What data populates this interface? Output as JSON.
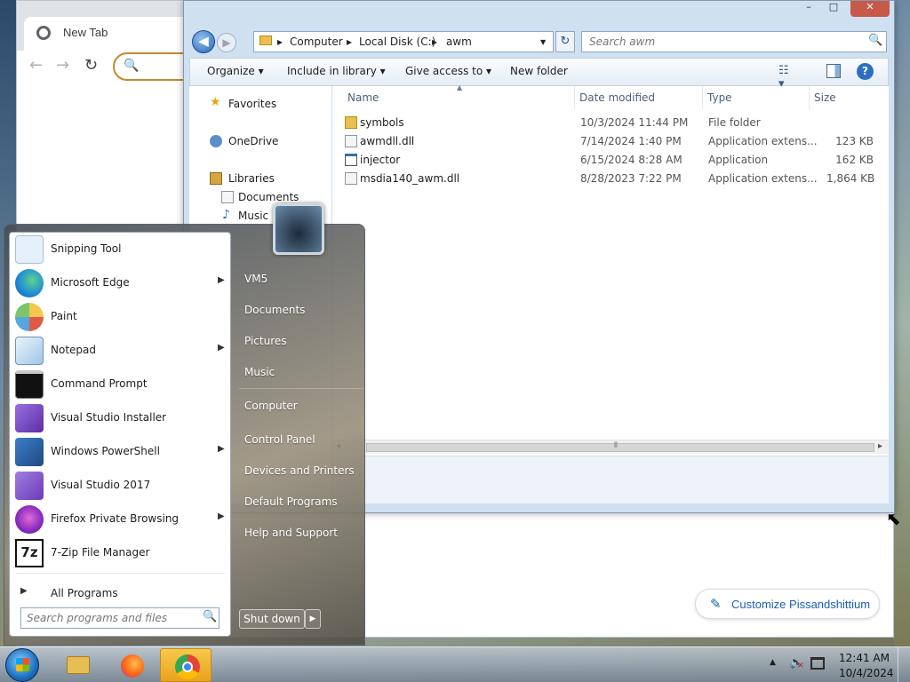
{
  "chrome": {
    "tab_title": "New Tab",
    "tab_close": "×",
    "nav_back": "←",
    "nav_forward": "→",
    "nav_reload": "↻",
    "omnibox_icon": "search-icon",
    "omnibox_glyph": "🔍",
    "customize_label": "Customize Pissandshittium",
    "customize_icon": "pencil-icon",
    "customize_glyph": "✎"
  },
  "explorer": {
    "window_buttons": {
      "minimize": "–",
      "maximize": "□",
      "close": "✕"
    },
    "nav_back_glyph": "◀",
    "nav_forward_glyph": "▶",
    "breadcrumb": [
      "Computer",
      "Local Disk (C:)",
      "awm"
    ],
    "breadcrumb_sep": "▸",
    "breadcrumb_dropdown": "▼",
    "refresh_glyph": "↻",
    "search_placeholder": "Search awm",
    "search_glyph": "🔍",
    "toolbar": {
      "organize": "Organize ▾",
      "include_in_library": "Include in library ▾",
      "give_access_to": "Give access to ▾",
      "new_folder": "New folder",
      "view_glyph": "☷ ▾",
      "help_glyph": "?"
    },
    "nav_pane": {
      "favorites": "Favorites",
      "onedrive": "OneDrive",
      "libraries": "Libraries",
      "documents": "Documents",
      "music": "Music"
    },
    "columns": {
      "name": "Name",
      "date_modified": "Date modified",
      "type": "Type",
      "size": "Size",
      "sort_glyph": "▲"
    },
    "files": [
      {
        "name": "symbols",
        "date": "10/3/2024 11:44 PM",
        "type": "File folder",
        "size": ""
      },
      {
        "name": "awmdll.dll",
        "date": "7/14/2024 1:40 PM",
        "type": "Application extens...",
        "size": "123 KB"
      },
      {
        "name": "injector",
        "date": "6/15/2024 8:28 AM",
        "type": "Application",
        "size": "162 KB"
      },
      {
        "name": "msdia140_awm.dll",
        "date": "8/28/2023 7:22 PM",
        "type": "Application extens...",
        "size": "1,864 KB"
      }
    ],
    "hscroll_left": "◂",
    "hscroll_right": "▸",
    "hscroll_grip": "⦀"
  },
  "start_menu": {
    "programs": [
      {
        "label": "Snipping Tool",
        "icon": "scissors-icon",
        "arrow": "",
        "color": "#e6f0fa"
      },
      {
        "label": "Microsoft Edge",
        "icon": "edge-icon",
        "arrow": "▶",
        "color": "#1f8fd6"
      },
      {
        "label": "Paint",
        "icon": "palette-icon",
        "arrow": "",
        "color": "#f2c94c"
      },
      {
        "label": "Notepad",
        "icon": "notepad-icon",
        "arrow": "▶",
        "color": "#cfe3f2"
      },
      {
        "label": "Command Prompt",
        "icon": "terminal-icon",
        "arrow": "",
        "color": "#111111"
      },
      {
        "label": "Visual Studio Installer",
        "icon": "vs-installer-icon",
        "arrow": "",
        "color": "#7a4fc0"
      },
      {
        "label": "Windows PowerShell",
        "icon": "powershell-icon",
        "arrow": "▶",
        "color": "#2a5f9e"
      },
      {
        "label": "Visual Studio 2017",
        "icon": "visual-studio-icon",
        "arrow": "",
        "color": "#8658c6"
      },
      {
        "label": "Firefox Private Browsing",
        "icon": "firefox-private-icon",
        "arrow": "▶",
        "color": "#9b3ac2"
      },
      {
        "label": "7-Zip File Manager",
        "icon": "7zip-icon",
        "arrow": "",
        "color": "#ffffff"
      }
    ],
    "all_programs": "All Programs",
    "all_programs_arrow": "▶",
    "search_placeholder": "Search programs and files",
    "search_glyph": "🔍",
    "right": [
      "VM5",
      "Documents",
      "Pictures",
      "Music",
      "Computer",
      "Control Panel",
      "Devices and Printers",
      "Default Programs",
      "Help and Support"
    ],
    "shutdown": "Shut down",
    "shutdown_arrow": "▶"
  },
  "taskbar": {
    "tray_show": "▲",
    "volume_glyph": "🔈",
    "volume_mute": "✕",
    "time": "12:41 AM",
    "date": "10/4/2024"
  },
  "cursor_glyph": "⬉"
}
